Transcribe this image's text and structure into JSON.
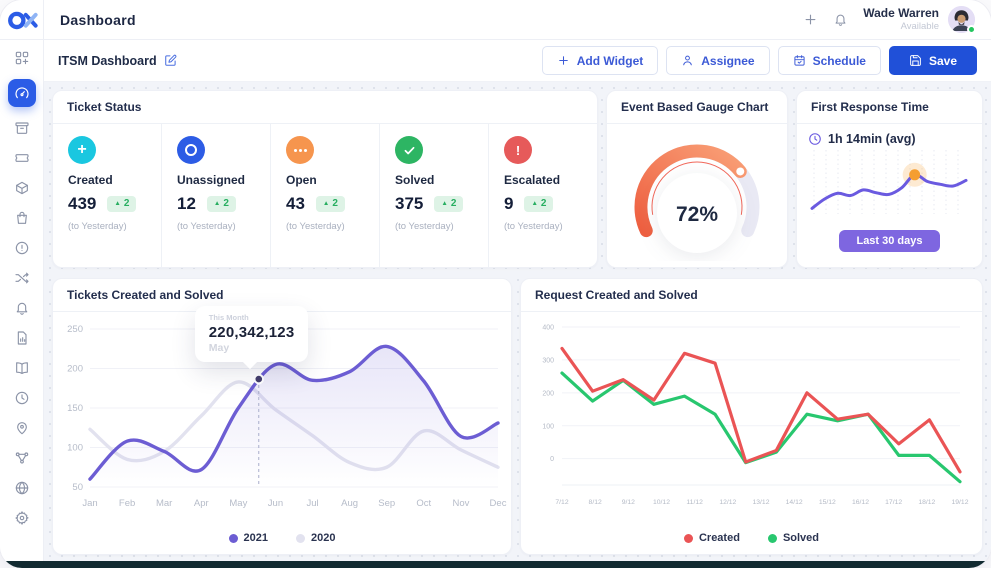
{
  "header": {
    "title": "Dashboard",
    "user": {
      "name": "Wade Warren",
      "status": "Available"
    }
  },
  "subheader": {
    "title": "ITSM Dashboard",
    "buttons": [
      {
        "id": "add-widget",
        "label": "Add Widget",
        "icon": "plus"
      },
      {
        "id": "assignee",
        "label": "Assignee",
        "icon": "user"
      },
      {
        "id": "schedule",
        "label": "Schedule",
        "icon": "calendar"
      },
      {
        "id": "save",
        "label": "Save",
        "icon": "save"
      }
    ]
  },
  "sidebar": {
    "items": [
      {
        "icon": "apps",
        "active": false
      },
      {
        "icon": "gauge",
        "active": true
      },
      {
        "icon": "archive",
        "active": false
      },
      {
        "icon": "ticket",
        "active": false
      },
      {
        "icon": "package",
        "active": false
      },
      {
        "icon": "bag",
        "active": false
      },
      {
        "icon": "alert",
        "active": false
      },
      {
        "icon": "shuffle",
        "active": false
      },
      {
        "icon": "bell",
        "active": false
      },
      {
        "icon": "report",
        "active": false
      },
      {
        "icon": "book",
        "active": false
      },
      {
        "icon": "history",
        "active": false
      },
      {
        "icon": "pin",
        "active": false
      },
      {
        "icon": "network",
        "active": false
      },
      {
        "icon": "globe",
        "active": false
      },
      {
        "icon": "gear",
        "active": false
      }
    ]
  },
  "ticket_status": {
    "title": "Ticket Status",
    "items": [
      {
        "label": "Created",
        "value": "439",
        "delta": "2",
        "note": "(to Yesterday)",
        "color": "#1ac7e0",
        "icon": "plus"
      },
      {
        "label": "Unassigned",
        "value": "12",
        "delta": "2",
        "note": "(to Yesterday)",
        "color": "#2d5ce5",
        "icon": "ring"
      },
      {
        "label": "Open",
        "value": "43",
        "delta": "2",
        "note": "(to Yesterday)",
        "color": "#f6954e",
        "icon": "dots"
      },
      {
        "label": "Solved",
        "value": "375",
        "delta": "2",
        "note": "(to Yesterday)",
        "color": "#2db563",
        "icon": "check"
      },
      {
        "label": "Escalated",
        "value": "9",
        "delta": "2",
        "note": "(to Yesterday)",
        "color": "#e65a5a",
        "icon": "exclaim"
      }
    ]
  },
  "gauge_card": {
    "title": "Event Based Gauge Chart"
  },
  "response_card": {
    "title": "First Response Time",
    "avg_label": "1h 14min (avg)",
    "badge": "Last 30 days"
  },
  "tickets_card": {
    "title": "Tickets Created and Solved"
  },
  "requests_card": {
    "title": "Request Created and Solved"
  },
  "chart_data": [
    {
      "id": "tickets",
      "type": "line",
      "title": "Tickets Created and Solved",
      "categories": [
        "Jan",
        "Feb",
        "Mar",
        "Apr",
        "May",
        "Jun",
        "Jul",
        "Aug",
        "Sep",
        "Oct",
        "Nov",
        "Dec"
      ],
      "series": [
        {
          "name": "2021",
          "color": "#6c5dd3",
          "fill": true,
          "values": [
            60,
            108,
            95,
            72,
            150,
            205,
            185,
            196,
            228,
            184,
            114,
            131
          ]
        },
        {
          "name": "2020",
          "color": "#e2e2ef",
          "fill": false,
          "values": [
            123,
            85,
            95,
            140,
            183,
            148,
            115,
            81,
            75,
            121,
            97,
            75
          ]
        }
      ],
      "ylim": [
        50,
        250
      ],
      "yticks": [
        50,
        100,
        150,
        200,
        250
      ],
      "grid": "horizontal",
      "legend_position": "bottom",
      "tooltip": {
        "label": "This Month",
        "value": "220,342,123",
        "sub": "May",
        "x_index": 4.55
      }
    },
    {
      "id": "requests",
      "type": "line",
      "title": "Request Created and Solved",
      "categories": [
        "7/12",
        "8/12",
        "9/12",
        "10/12",
        "11/12",
        "12/12",
        "13/12",
        "14/12",
        "15/12",
        "16/12",
        "17/12",
        "18/12",
        "19/12"
      ],
      "series": [
        {
          "name": "Created",
          "color": "#ea5455",
          "values": [
            335,
            205,
            240,
            178,
            320,
            290,
            -10,
            25,
            200,
            120,
            135,
            45,
            118,
            -40
          ]
        },
        {
          "name": "Solved",
          "color": "#28c76f",
          "values": [
            260,
            175,
            238,
            165,
            190,
            135,
            -12,
            20,
            135,
            115,
            135,
            10,
            10,
            -70
          ]
        }
      ],
      "ylim": [
        -80,
        400
      ],
      "yticks": [
        0,
        100,
        200,
        300,
        400
      ],
      "grid": "horizontal",
      "legend_position": "bottom"
    },
    {
      "id": "response_sparkline",
      "type": "line",
      "title": "First Response Time trend (Last 30 days)",
      "color": "#6a5ae0",
      "values": [
        10,
        27,
        37,
        33,
        43,
        38,
        35,
        47,
        70,
        58,
        53,
        50,
        60
      ],
      "highlight_index": 8,
      "highlight_color": "#f59e31"
    },
    {
      "id": "gauge",
      "type": "gauge",
      "title": "Event Based Gauge Chart",
      "value": 72,
      "max": 100,
      "display": "72%",
      "color_start": "#ee5f40",
      "color_end": "#f9a077",
      "track_color": "#e9e9f4"
    }
  ]
}
